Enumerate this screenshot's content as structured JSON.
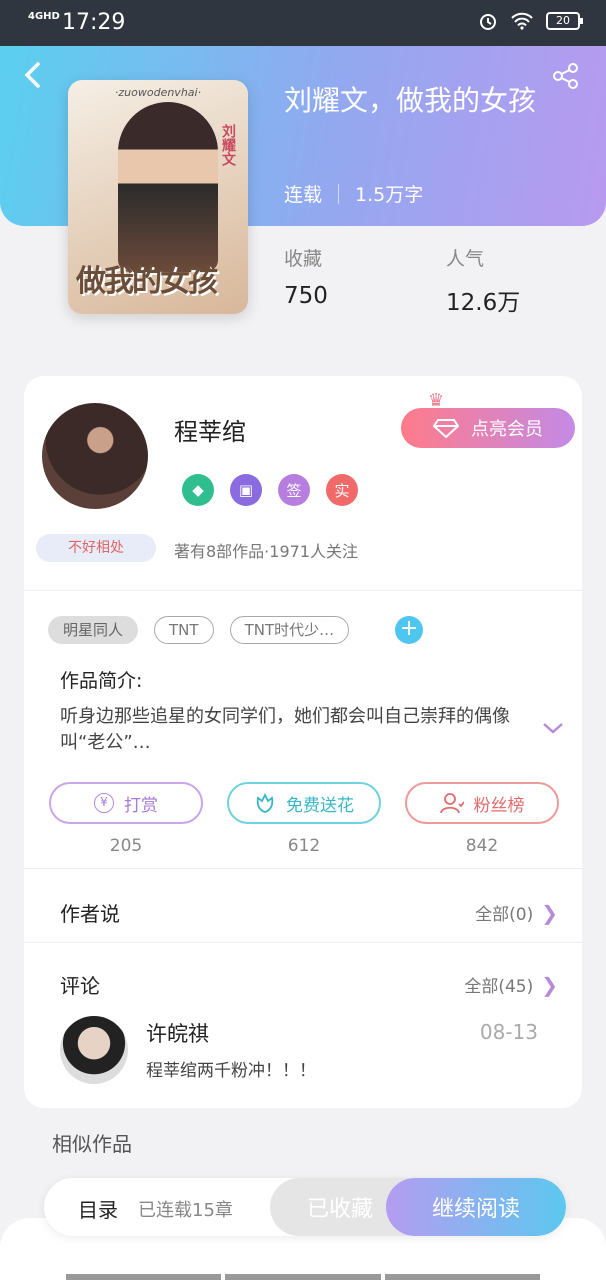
{
  "status_bar": {
    "network": "4GHD",
    "time": "17:29",
    "battery": "20"
  },
  "book": {
    "cover_top": "·zuowodenvhai·",
    "cover_title": "做我的女孩",
    "cover_side": "刘耀文",
    "title": "刘耀文，做我的女孩",
    "status": "连载",
    "word_count": "1.5万字",
    "favorites_label": "收藏",
    "favorites_value": "750",
    "popularity_label": "人气",
    "popularity_value": "12.6万"
  },
  "author": {
    "name": "程莘绾",
    "vip_button": "点亮会员",
    "badges": [
      {
        "icon": "diamond-icon",
        "color": "#2fbf8f"
      },
      {
        "icon": "calendar-icon",
        "color": "#8a6be0"
      },
      {
        "label": "签",
        "color": "#b77ee0"
      },
      {
        "label": "实",
        "color": "#f06a6a"
      }
    ],
    "pill_tag": "不好相处",
    "stats": "著有8部作品·1971人关注"
  },
  "tags": [
    "明星同人",
    "TNT",
    "TNT时代少…"
  ],
  "intro": {
    "heading": "作品简介:",
    "text": "听身边那些追星的女同学们，她们都会叫自己崇拜的偶像叫“老公”…"
  },
  "actions": [
    {
      "label": "打赏",
      "icon": "yen-icon",
      "count": "205",
      "color": "#b48ae0"
    },
    {
      "label": "免费送花",
      "icon": "flower-icon",
      "count": "612",
      "color": "#4fc6d8"
    },
    {
      "label": "粉丝榜",
      "icon": "fans-icon",
      "count": "842",
      "color": "#ea7b7b"
    }
  ],
  "author_says": {
    "heading": "作者说",
    "more": "全部(0)"
  },
  "comments": {
    "heading": "评论",
    "more": "全部(45)",
    "items": [
      {
        "name": "许皖祺",
        "date": "08-13",
        "text": "程莘绾两千粉冲！！！"
      }
    ]
  },
  "similar_heading": "相似作品",
  "bottom_bar": {
    "toc": "目录",
    "chapters": "已连载15章",
    "favorited": "已收藏",
    "continue": "继续阅读"
  }
}
